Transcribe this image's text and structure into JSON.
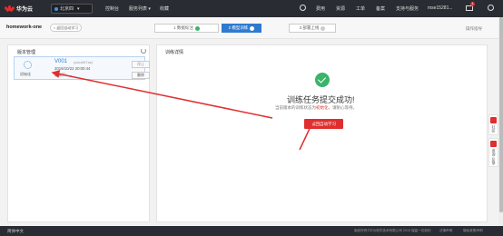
{
  "header": {
    "logo_text": "华为云",
    "region": "北京四",
    "nav": [
      "控制台",
      "服务列表 ▾",
      "收藏"
    ],
    "right": [
      "费用",
      "资源",
      "工单",
      "备案",
      "支持与服务"
    ],
    "username": "mse15281...",
    "notification_count": "1"
  },
  "subheader": {
    "project_name": "homework-one",
    "back_label": "< 返回自动学习",
    "steps": [
      {
        "label": "1 数据标注"
      },
      {
        "label": "2 模型训练"
      },
      {
        "label": "3 部署上线"
      }
    ],
    "operation_guide": "操作指导"
  },
  "left_panel": {
    "title": "版本管理",
    "version": {
      "status": "初始化",
      "name": "V001",
      "id": "(a4cd0f7ae)",
      "time": "2019/10/22 20:00:44",
      "rate_label": "准确率：--",
      "stop_label": "停止",
      "delete_label": "删除"
    }
  },
  "right_panel": {
    "title": "训练详情",
    "success_message": "训练任务提交成功!",
    "status_prefix": "当前版本的训练状态为",
    "status_value": "初始化",
    "status_suffix": "，请耐心等待。",
    "return_label": "返回自动学习"
  },
  "side": {
    "community": "社区",
    "feedback": "咨询·反馈"
  },
  "footer": {
    "language": "简体中文",
    "copyright": "版权所有©华为软件技术有限公司 2019 保留一切权利",
    "legal": "法律声明",
    "privacy": "隐私政策声明"
  },
  "colors": {
    "header_bg": "#292d33",
    "accent_red": "#e02e2e",
    "active_step": "#2e7ad1",
    "success_green": "#3ab36b"
  }
}
